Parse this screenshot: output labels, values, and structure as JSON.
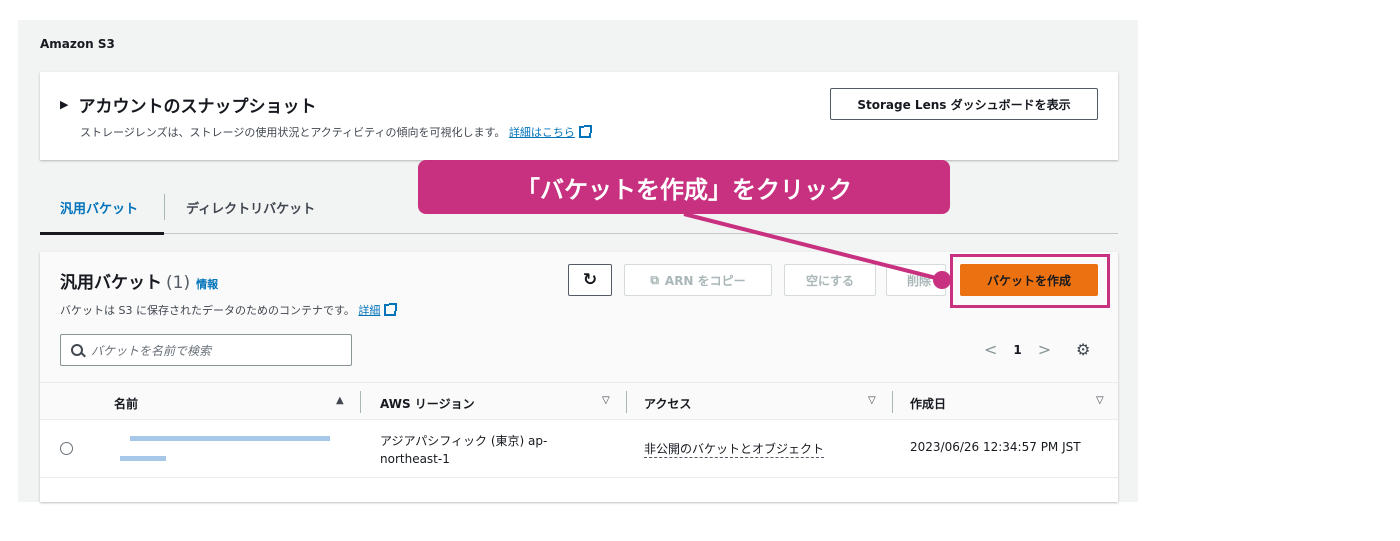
{
  "breadcrumb": "Amazon S3",
  "snapshot": {
    "title": "アカウントのスナップショット",
    "description": "ストレージレンズは、ストレージの使用状況とアクティビティの傾向を可視化します。",
    "link": "詳細はこちら",
    "lens_button": "Storage Lens ダッシュボードを表示"
  },
  "tabs": [
    {
      "label": "汎用バケット"
    },
    {
      "label": "ディレクトリバケット"
    }
  ],
  "panel": {
    "title": "汎用バケット",
    "count": "(1)",
    "info": "情報",
    "description": "バケットは S3 に保存されたデータのためのコンテナです。",
    "detail_link": "詳細",
    "buttons": {
      "refresh": "↻",
      "copy_arn": "ARN をコピー",
      "empty": "空にする",
      "delete": "削除",
      "create": "バケットを作成"
    },
    "search_placeholder": "バケットを名前で検索",
    "page_number": "1"
  },
  "table": {
    "columns": [
      "名前",
      "AWS リージョン",
      "アクセス",
      "作成日"
    ],
    "rows": [
      {
        "region": "アジアパシフィック (東京) ap-northeast-1",
        "access": "非公開のバケットとオブジェクト",
        "created": "2023/06/26 12:34:57 PM JST"
      }
    ]
  },
  "callout": "「バケットを作成」をクリック",
  "colors": {
    "accent": "#ec7211",
    "highlight": "#c8317f",
    "link": "#0073bb"
  }
}
